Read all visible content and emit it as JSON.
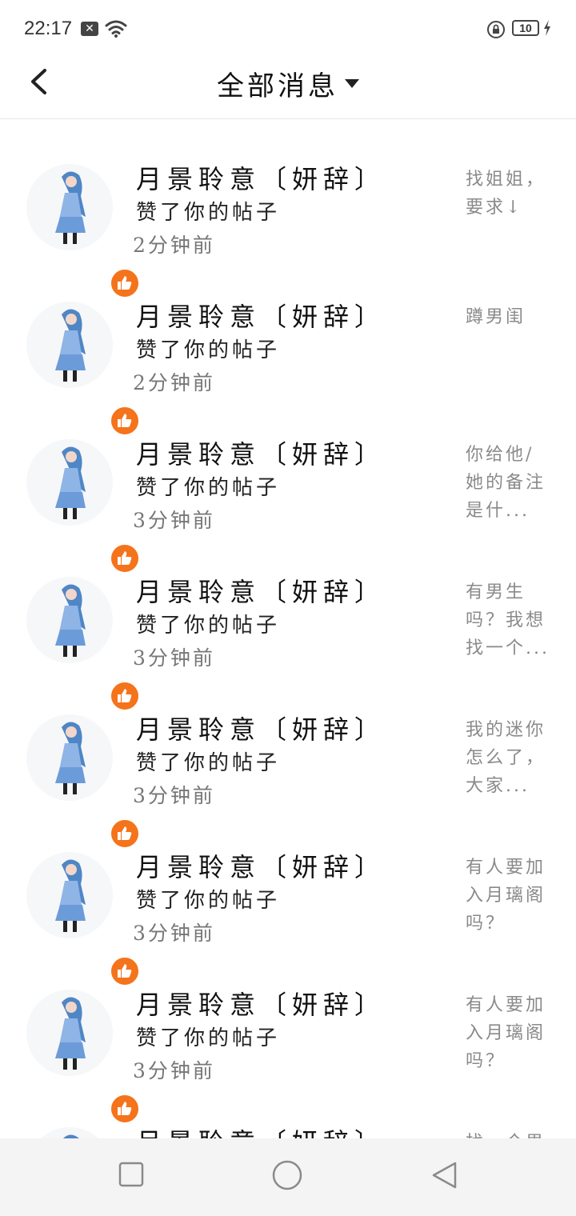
{
  "status_bar": {
    "time": "22:17",
    "battery": "10",
    "icons": [
      "x-notification-icon",
      "wifi-icon",
      "rotation-lock-icon",
      "battery-icon",
      "charging-icon"
    ]
  },
  "header": {
    "title": "全部消息",
    "back_icon": "back-chevron-icon",
    "dropdown_icon": "caret-down-icon"
  },
  "colors": {
    "like_badge": "#f5731a",
    "divider": "#e6e6e6",
    "nav_bar": "#f4f4f4",
    "preview_text": "#8a8a8a",
    "time_text": "#777777"
  },
  "messages": [
    {
      "name": "月景聆意〔妍辞〕",
      "action": "赞了你的帖子",
      "time": "2分钟前",
      "preview": "找姐姐，要求↓"
    },
    {
      "name": "月景聆意〔妍辞〕",
      "action": "赞了你的帖子",
      "time": "2分钟前",
      "preview": "蹲男闺"
    },
    {
      "name": "月景聆意〔妍辞〕",
      "action": "赞了你的帖子",
      "time": "3分钟前",
      "preview": "你给他/她的备注是什..."
    },
    {
      "name": "月景聆意〔妍辞〕",
      "action": "赞了你的帖子",
      "time": "3分钟前",
      "preview": "有男生吗？我想找一个..."
    },
    {
      "name": "月景聆意〔妍辞〕",
      "action": "赞了你的帖子",
      "time": "3分钟前",
      "preview": "我的迷你怎么了，大家..."
    },
    {
      "name": "月景聆意〔妍辞〕",
      "action": "赞了你的帖子",
      "time": "3分钟前",
      "preview": "有人要加入月璃阁吗？"
    },
    {
      "name": "月景聆意〔妍辞〕",
      "action": "赞了你的帖子",
      "time": "3分钟前",
      "preview": "有人要加入月璃阁吗？"
    },
    {
      "name": "月景聆意〔妍辞〕",
      "action": "",
      "time": "",
      "preview": "找一个男"
    }
  ],
  "nav_bar": {
    "icons": [
      "recents-square-icon",
      "home-circle-icon",
      "back-triangle-icon"
    ]
  }
}
